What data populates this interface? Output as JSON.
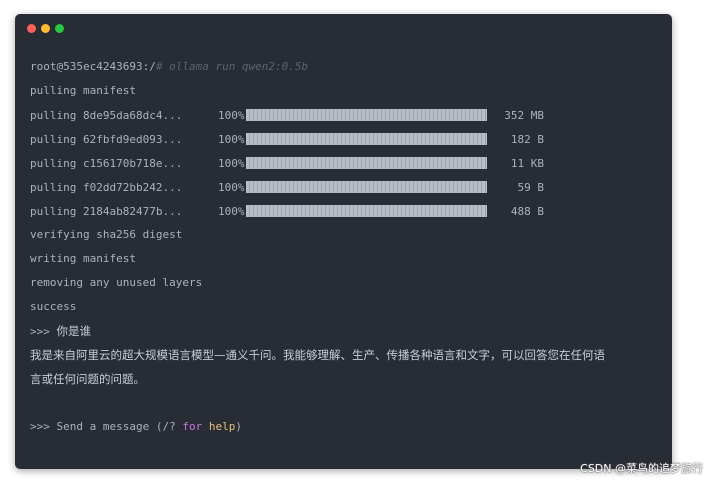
{
  "window": {
    "traffic_lights": {
      "close_color": "#ff5f56",
      "minimize_color": "#ffbd2e",
      "zoom_color": "#27c93f"
    }
  },
  "terminal": {
    "prompt": {
      "user_host": "root@535ec4243693:/",
      "command": "# ollama run qwen2:0.5b"
    },
    "pulling_manifest": "pulling manifest",
    "pulls": [
      {
        "label": "pulling 8de95da68dc4...",
        "percent": "100%",
        "progress": 1.0,
        "size": "352 MB"
      },
      {
        "label": "pulling 62fbfd9ed093...",
        "percent": "100%",
        "progress": 1.0,
        "size": "182 B"
      },
      {
        "label": "pulling c156170b718e...",
        "percent": "100%",
        "progress": 1.0,
        "size": "11 KB"
      },
      {
        "label": "pulling f02dd72bb242...",
        "percent": "100%",
        "progress": 1.0,
        "size": "59 B"
      },
      {
        "label": "pulling 2184ab82477b...",
        "percent": "100%",
        "progress": 1.0,
        "size": "488 B"
      }
    ],
    "verifying": "verifying sha256 digest",
    "writing": "writing manifest",
    "removing": "removing any unused layers",
    "success": "success",
    "chat": {
      "prompt_marker": ">>> ",
      "user_question": "你是谁",
      "answer": "我是来自阿里云的超大规模语言模型—通义千问。我能够理解、生产、传播各种语言和文字，可以回答您在任何语言或任何问题的问题。",
      "input_prefix": ">>> Send a message (/? ",
      "input_for": "for",
      "input_space": " ",
      "input_help": "help",
      "input_suffix": ")"
    }
  },
  "watermark": "CSDN @菜鸟的追梦旅行"
}
